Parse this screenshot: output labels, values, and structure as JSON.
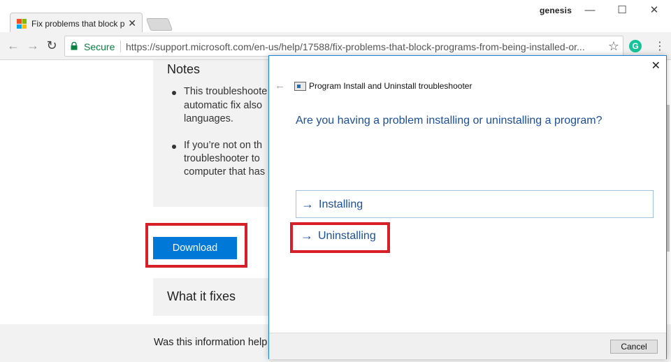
{
  "browser": {
    "tab_title": "Fix problems that block p",
    "tab_close": "✕",
    "profile": "genesis",
    "window_minimize": "—",
    "window_maximize": "☐",
    "window_close": "✕",
    "nav_back": "←",
    "nav_forward": "→",
    "nav_reload": "↻",
    "secure_label": "Secure",
    "url": "https://support.microsoft.com/en-us/help/17588/fix-problems-that-block-programs-from-being-installed-or...",
    "bookmark_icon": "☆",
    "extension_label": "G",
    "menu_icon": "⋮",
    "colors": {
      "secure": "#0b8043",
      "extension": "#15c39a"
    }
  },
  "page": {
    "notes_title": "Notes",
    "notes": [
      [
        "This troubleshoote",
        "automatic fix also",
        "languages."
      ],
      [
        "If you’re not on th",
        "troubleshooter to",
        "computer that has"
      ]
    ],
    "download_label": "Download",
    "what_it_fixes": "What it fixes",
    "feedback_question": "Was this information help",
    "colors": {
      "download": "#0078d7",
      "highlight": "#d61f26"
    }
  },
  "dialog": {
    "close_icon": "✕",
    "back_icon": "←",
    "title": "Program Install and Uninstall troubleshooter",
    "question": "Are you having a problem installing or uninstalling a program?",
    "options": [
      {
        "arrow": "→",
        "label": "Installing"
      },
      {
        "arrow": "→",
        "label": "Uninstalling"
      }
    ],
    "cancel_label": "Cancel",
    "colors": {
      "text": "#1a4f9a",
      "border": "#1883d7"
    }
  }
}
